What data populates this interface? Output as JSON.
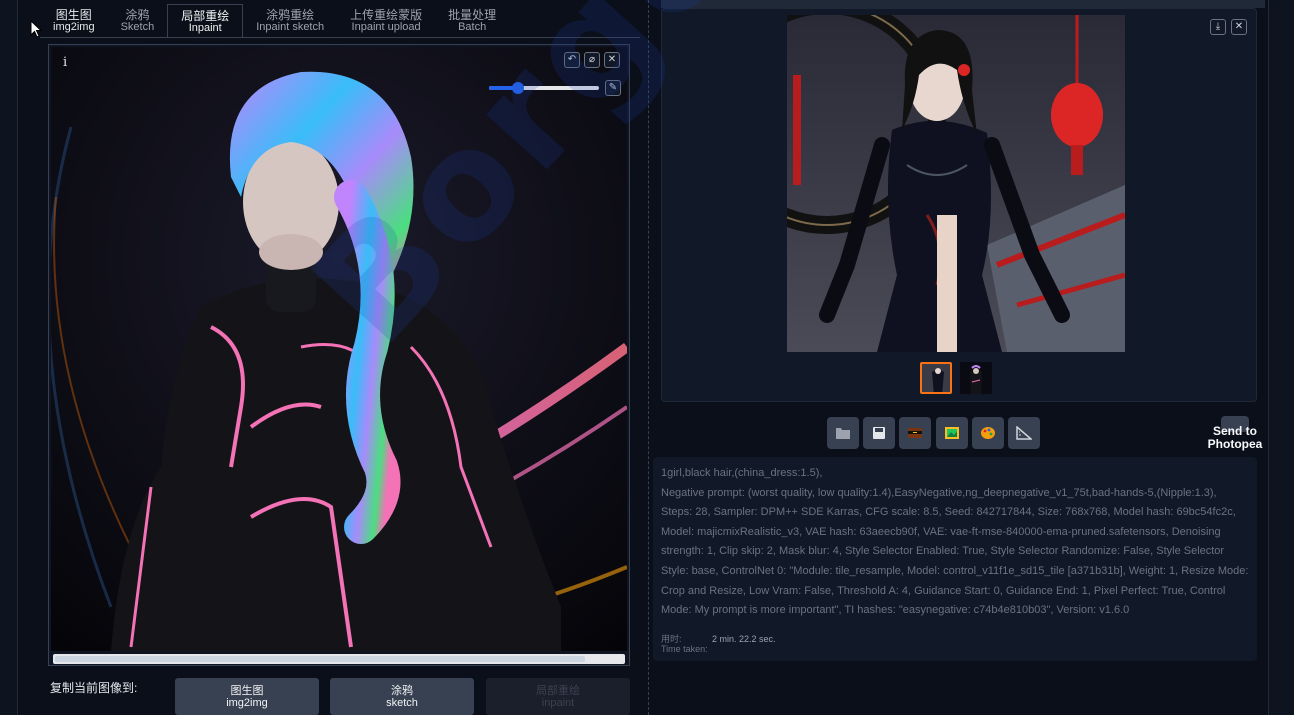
{
  "tabs": [
    {
      "zh": "图生图",
      "en": "img2img"
    },
    {
      "zh": "涂鸦",
      "en": "Sketch"
    },
    {
      "zh": "局部重绘",
      "en": "Inpaint"
    },
    {
      "zh": "涂鸦重绘",
      "en": "Inpaint sketch"
    },
    {
      "zh": "上传重绘蒙版",
      "en": "Inpaint upload"
    },
    {
      "zh": "批量处理",
      "en": "Batch"
    }
  ],
  "editor": {
    "info_icon": "i",
    "brush_size_fraction": 0.26,
    "icons": [
      "undo-icon",
      "eraser-icon",
      "close-icon",
      "brush-icon"
    ]
  },
  "copy_to": {
    "label": "复制当前图像到:",
    "buttons": [
      {
        "zh": "图生图",
        "en": "img2img"
      },
      {
        "zh": "涂鸦",
        "en": "sketch"
      },
      {
        "zh": "局部重绘",
        "en": "inpaint"
      }
    ]
  },
  "gallery": {
    "icons": [
      "download-icon",
      "close-icon"
    ],
    "thumbnails": 2,
    "selected_thumbnail": 0
  },
  "actions": {
    "icons": [
      "folder-icon",
      "save-icon",
      "zip-icon",
      "image-icon",
      "palette-icon",
      "ruler-icon"
    ],
    "send_to_photopea": "Send to\nPhotopea"
  },
  "generation_info": {
    "prompt": "1girl,black hair,(china_dress:1.5),",
    "negative": "Negative prompt: (worst quality, low quality:1.4),EasyNegative,ng_deepnegative_v1_75t,bad-hands-5,(Nipple:1.3),",
    "params": "Steps: 28, Sampler: DPM++ SDE Karras, CFG scale: 8.5, Seed: 842717844, Size: 768x768, Model hash: 69bc54fc2c, Model: majicmixRealistic_v3, VAE hash: 63aeecb90f, VAE: vae-ft-mse-840000-ema-pruned.safetensors, Denoising strength: 1, Clip skip: 2, Mask blur: 4, Style Selector Enabled: True, Style Selector Randomize: False, Style Selector Style: base, ControlNet 0: \"Module: tile_resample, Model: control_v11f1e_sd15_tile [a371b31b], Weight: 1, Resize Mode: Crop and Resize, Low Vram: False, Threshold A: 4, Guidance Start: 0, Guidance End: 1, Pixel Perfect: True, Control Mode: My prompt is more important\", TI hashes: \"easynegative: c74b4e810b03\", Version: v1.6.0"
  },
  "time": {
    "label_zh": "用时:",
    "label_en": "Time taken:",
    "value": "2 min. 22.2 sec."
  },
  "watermark": "Borger",
  "colors": {
    "accent": "#2563eb",
    "selected_thumb": "#f97316",
    "bg": "#0b0f19"
  }
}
